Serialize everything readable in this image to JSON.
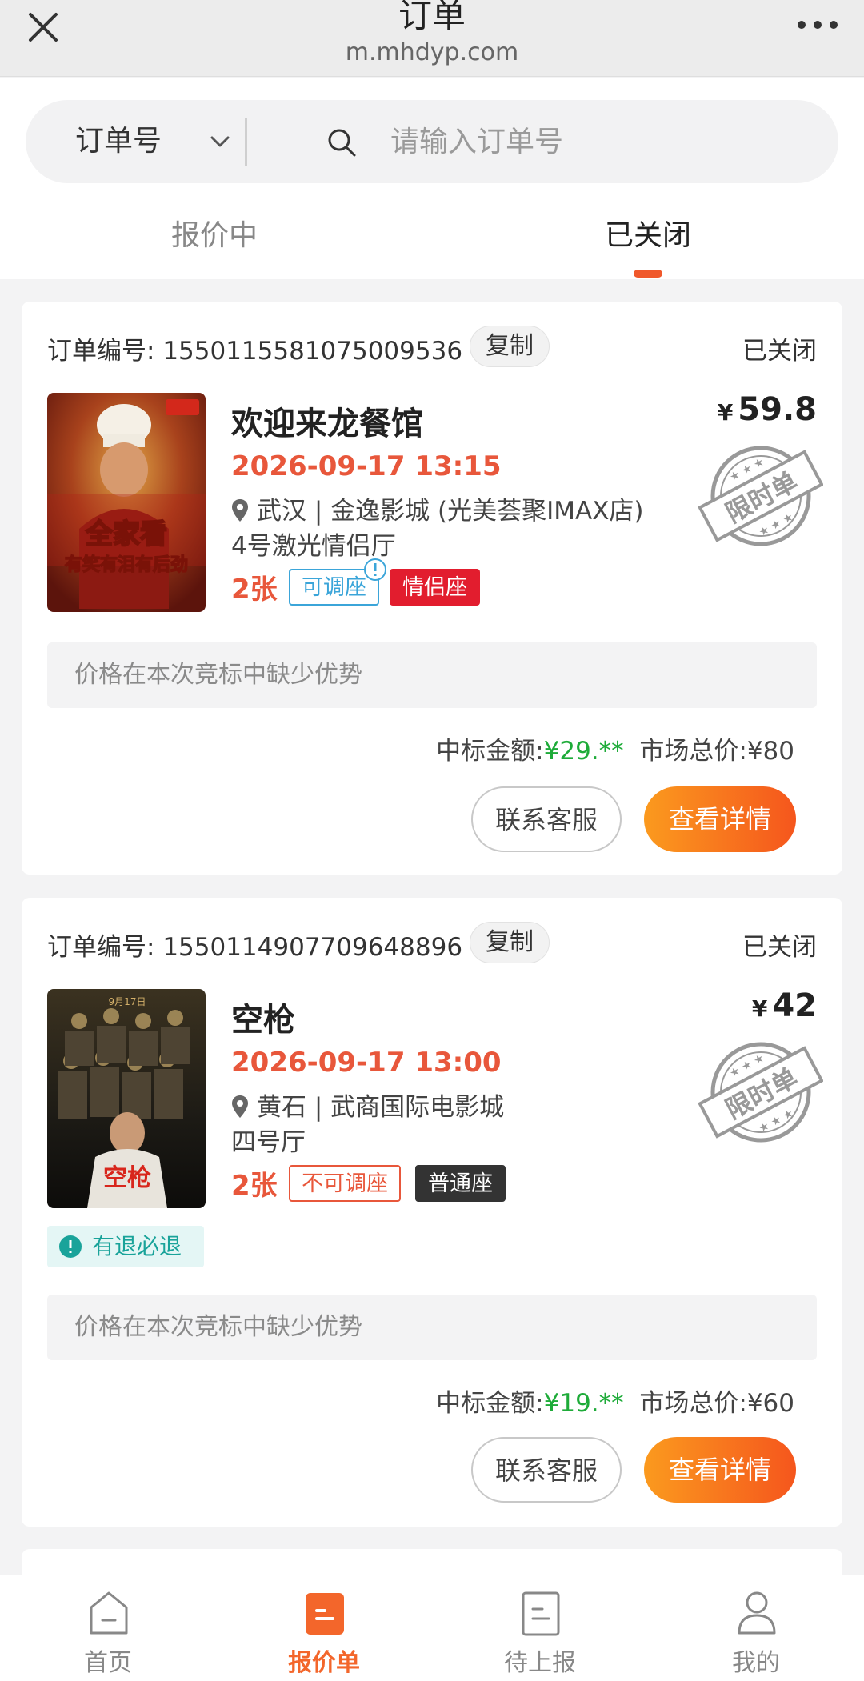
{
  "browser": {
    "title": "订单",
    "host": "m.mhdyp.com"
  },
  "search": {
    "type_label": "订单号",
    "placeholder": "请输入订单号"
  },
  "tabs": [
    {
      "label": "报价中"
    },
    {
      "label": "已关闭"
    }
  ],
  "orders": [
    {
      "order_prefix": "订单编号:",
      "order_no": "1550115581075009536",
      "copy_label": "复制",
      "status": "已关闭",
      "movie": "欢迎来龙餐馆",
      "price_currency": "¥",
      "price": "59.8",
      "datetime": "2026-09-17 13:15",
      "location": "武汉 | 金逸影城 (光美荟聚IMAX店)",
      "hall": "4号激光情侣厅",
      "count": "2张",
      "seat_adjust": "可调座",
      "seat_type": "情侣座",
      "stamp": "限时单",
      "reason": "价格在本次竞标中缺少优势",
      "winning_label": "中标金额:",
      "winning_amount": "¥29.**",
      "market_label": "市场总价:",
      "market_amount": "¥80",
      "contact_label": "联系客服",
      "detail_label": "查看详情"
    },
    {
      "order_prefix": "订单编号:",
      "order_no": "1550114907709648896",
      "copy_label": "复制",
      "status": "已关闭",
      "movie": "空枪",
      "price_currency": "¥",
      "price": "42",
      "datetime": "2026-09-17 13:00",
      "location": "黄石 | 武商国际电影城",
      "hall": "四号厅",
      "count": "2张",
      "seat_adjust": "不可调座",
      "seat_type": "普通座",
      "stamp": "限时单",
      "refund": "有退必退",
      "reason": "价格在本次竞标中缺少优势",
      "winning_label": "中标金额:",
      "winning_amount": "¥19.**",
      "market_label": "市场总价:",
      "market_amount": "¥60",
      "contact_label": "联系客服",
      "detail_label": "查看详情"
    }
  ],
  "bottom_nav": [
    {
      "label": "首页",
      "icon": "home-icon"
    },
    {
      "label": "报价单",
      "icon": "quote-icon",
      "active": true
    },
    {
      "label": "待上报",
      "icon": "report-icon"
    },
    {
      "label": "我的",
      "icon": "user-icon"
    }
  ],
  "colors": {
    "accent": "#f0582b",
    "price_red": "#e8573b",
    "green": "#1eab39",
    "teal": "#19a39a"
  }
}
